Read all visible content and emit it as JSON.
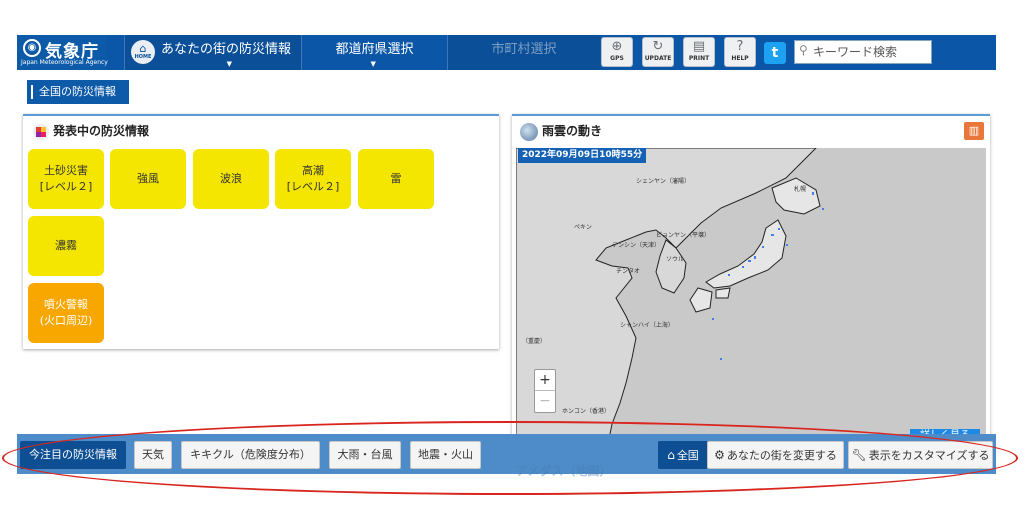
{
  "header": {
    "logo_name": "気象庁",
    "logo_sub": "Japan Meteorological Agency",
    "nav": {
      "home_icon_text": "HOME",
      "local_info": "あなたの街の防災情報",
      "prefecture": "都道府県選択",
      "city": "市町村選択"
    },
    "tools": [
      {
        "label": "GPS",
        "icon": "gps-icon"
      },
      {
        "label": "UPDATE",
        "icon": "update-icon"
      },
      {
        "label": "PRINT",
        "icon": "print-icon"
      },
      {
        "label": "HELP",
        "icon": "help-icon"
      }
    ],
    "twitter_icon": "twitter-icon",
    "search_placeholder": "キーワード検索"
  },
  "breadcrumb": "全国の防災情報",
  "warnings_panel": {
    "title": "発表中の防災情報",
    "tiles": [
      {
        "label": "土砂災害\n[レベル２]",
        "color": "#f4e600"
      },
      {
        "label": "強風",
        "color": "#f4e600"
      },
      {
        "label": "波浪",
        "color": "#f4e600"
      },
      {
        "label": "高潮\n[レベル２]",
        "color": "#f4e600"
      },
      {
        "label": "雷",
        "color": "#f4e600"
      },
      {
        "label": "濃霧",
        "color": "#f4e600"
      },
      {
        "label": "噴火警報\n(火口周辺)",
        "color": "#f7a700"
      }
    ]
  },
  "radar_panel": {
    "title": "雨雲の動き",
    "timestamp": "2022年09月09日10時55分",
    "map_labels": [
      "シェンヤン（瀋陽）",
      "札幌",
      "ペキン",
      "ピョンヤン（平壌）",
      "テンシン（天津）",
      "ソウル",
      "チンタオ",
      "シャンハイ（上海）",
      "（重慶）",
      "ホンコン（香港）"
    ],
    "zoom_in": "+",
    "zoom_out": "−",
    "detail_button": "詳しく見る"
  },
  "bottom_bar": {
    "focus": "今注目の防災情報",
    "weather": "天気",
    "kikikuru": "キキクル（危険度分布）",
    "rain_typhoon": "大雨・台風",
    "quake_volcano": "地震・火山",
    "all": "全国",
    "change_local": "あなたの街を変更する",
    "customize": "表示をカスタマイズする",
    "amedas_peek": "アメダス（地図）"
  },
  "colors": {
    "header_blue": "#0b56a6",
    "bottom_bar_blue": "#4d8cc8",
    "warning_yellow": "#f4e600",
    "warning_orange": "#f7a700",
    "annotation_red": "#d8261f"
  }
}
